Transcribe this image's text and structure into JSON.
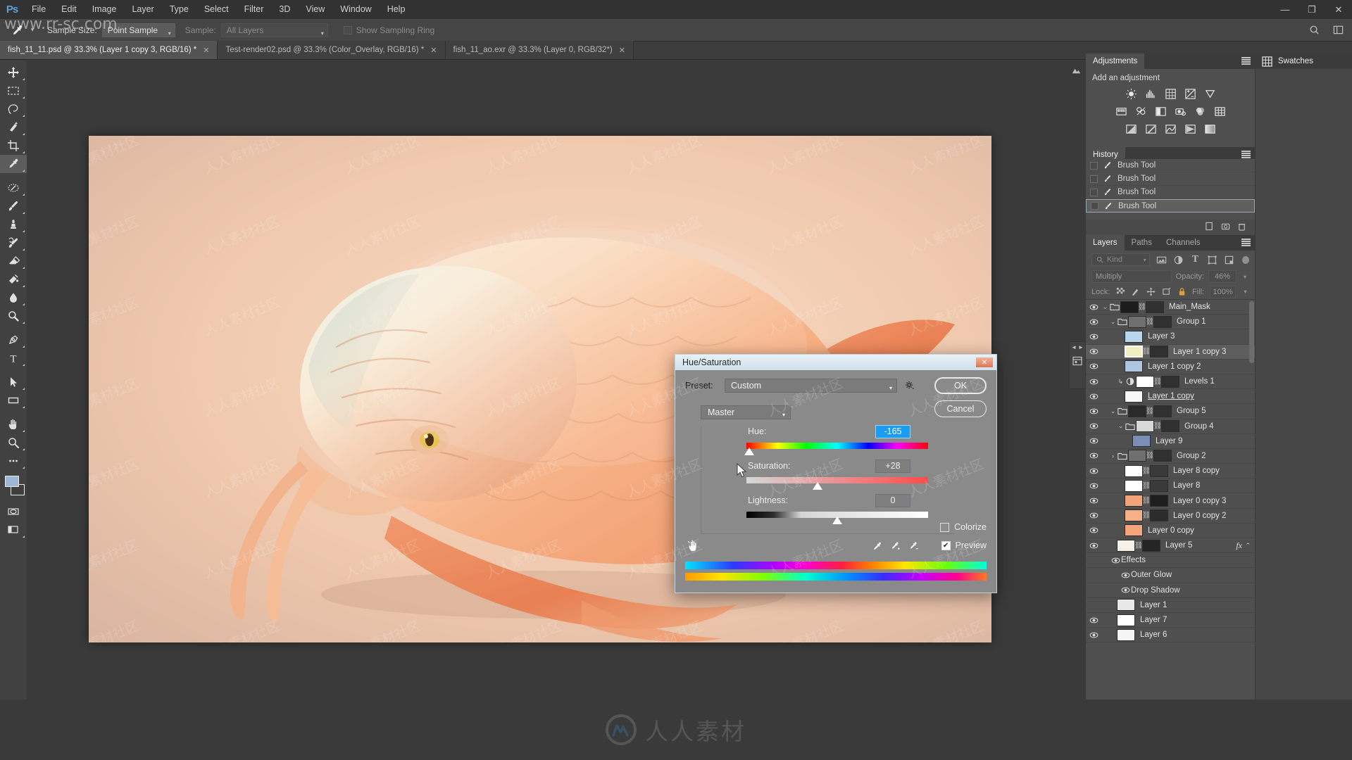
{
  "app": {
    "logo": "Ps",
    "watermark_site": "www.rr-sc.com",
    "watermark_brand": "人人素材",
    "watermark_tile": "人人素材社区"
  },
  "menubar": {
    "items": [
      "File",
      "Edit",
      "Image",
      "Layer",
      "Type",
      "Select",
      "Filter",
      "3D",
      "View",
      "Window",
      "Help"
    ]
  },
  "window_controls": {
    "minimize": "—",
    "restore": "❐",
    "close": "✕"
  },
  "options_bar": {
    "tool_icon": "eyedropper-icon",
    "sample_size_label": "Sample Size:",
    "sample_size_value": "Point Sample",
    "sample_label": "Sample:",
    "sample_value": "All Layers",
    "show_sampling_ring": "Show Sampling Ring"
  },
  "document_tabs": [
    {
      "title": "fish_11_11.psd @ 33.3% (Layer 1 copy 3, RGB/16) *",
      "close": "✕",
      "active": true
    },
    {
      "title": "Test-render02.psd @ 33.3% (Color_Overlay, RGB/16) *",
      "close": "✕",
      "active": false
    },
    {
      "title": "fish_11_ao.exr @ 33.3% (Layer 0, RGB/32*)",
      "close": "✕",
      "active": false
    }
  ],
  "toolbar": {
    "tools": [
      {
        "name": "move-tool",
        "glyph": "✥"
      },
      {
        "name": "rectangular-marquee-tool",
        "glyph": "▭"
      },
      {
        "name": "lasso-tool",
        "glyph": "✒"
      },
      {
        "name": "quick-selection-tool",
        "glyph": "✨"
      },
      {
        "name": "crop-tool",
        "glyph": "⌗"
      },
      {
        "name": "eyedropper-tool",
        "glyph": "⚲",
        "active": true
      },
      {
        "name": "spot-healing-brush-tool",
        "glyph": "✚"
      },
      {
        "name": "brush-tool",
        "glyph": "🖌"
      },
      {
        "name": "clone-stamp-tool",
        "glyph": "⎘"
      },
      {
        "name": "history-brush-tool",
        "glyph": "↺"
      },
      {
        "name": "eraser-tool",
        "glyph": "▰"
      },
      {
        "name": "gradient-tool",
        "glyph": "◨"
      },
      {
        "name": "blur-tool",
        "glyph": "💧"
      },
      {
        "name": "dodge-tool",
        "glyph": "🔍"
      },
      {
        "name": "pen-tool",
        "glyph": "✎"
      },
      {
        "name": "type-tool",
        "glyph": "T"
      },
      {
        "name": "path-selection-tool",
        "glyph": "➤"
      },
      {
        "name": "rectangle-tool",
        "glyph": "▭"
      },
      {
        "name": "hand-tool",
        "glyph": "✋"
      },
      {
        "name": "zoom-tool",
        "glyph": "🔎"
      },
      {
        "name": "edit-toolbar-tool",
        "glyph": "•••"
      }
    ],
    "foreground_color": "#9fb7d4",
    "background_color": "#3e3e3e",
    "quick-mask": "quick-mask-icon",
    "screen-mode": "screen-mode-icon"
  },
  "canvas": {
    "artwork_name": "dragon-fish-artwork",
    "zoom": "33.3%"
  },
  "adjustments_panel": {
    "tab_label": "Adjustments",
    "title": "Add an adjustment",
    "icons_row1": [
      "brightness-contrast-icon",
      "levels-icon",
      "curves-icon",
      "exposure-icon",
      "vibrance-icon"
    ],
    "icons_row2": [
      "hue-saturation-icon",
      "color-balance-icon",
      "black-white-icon",
      "photo-filter-icon",
      "channel-mixer-icon",
      "color-lookup-icon"
    ],
    "icons_row3": [
      "invert-icon",
      "posterize-icon",
      "threshold-icon",
      "gradient-map-icon",
      "selective-color-icon"
    ]
  },
  "history_panel": {
    "tab_label": "History",
    "entries": [
      {
        "label": "Brush Tool",
        "selected": false
      },
      {
        "label": "Brush Tool",
        "selected": false
      },
      {
        "label": "Brush Tool",
        "selected": false
      },
      {
        "label": "Brush Tool",
        "selected": true
      }
    ],
    "footer_icons": [
      "new-document-from-state-icon",
      "new-snapshot-icon",
      "delete-icon"
    ]
  },
  "layers_panel": {
    "tabs": [
      {
        "label": "Layers",
        "active": true
      },
      {
        "label": "Paths",
        "active": false
      },
      {
        "label": "Channels",
        "active": false
      }
    ],
    "filter": {
      "kind_label": "Kind",
      "icons": [
        "pixel-filter-icon",
        "adjustment-filter-icon",
        "type-filter-icon",
        "shape-filter-icon",
        "smart-object-filter-icon"
      ]
    },
    "blend_mode": "Multiply",
    "opacity_label": "Opacity:",
    "opacity_value": "46%",
    "lock_label": "Lock:",
    "lock_icons": [
      "lock-transparent-pixels-icon",
      "lock-image-pixels-icon",
      "lock-position-icon",
      "lock-artboard-icon",
      "lock-all-icon"
    ],
    "fill_label": "Fill:",
    "fill_value": "100%",
    "layers": [
      {
        "name": "Main_Mask",
        "indent": 0,
        "type": "group",
        "expanded": true,
        "visible": true,
        "thumb": "#1c1c1c",
        "mask": true,
        "selected": false
      },
      {
        "name": "Group 1",
        "indent": 1,
        "type": "group",
        "expanded": true,
        "visible": true,
        "thumb": "#6f6f6f",
        "mask": true,
        "selected": false
      },
      {
        "name": "Layer 3",
        "indent": 2,
        "type": "layer",
        "visible": true,
        "thumb": "#b9d6ef",
        "mask": false,
        "selected": false
      },
      {
        "name": "Layer 1 copy 3",
        "indent": 2,
        "type": "layer",
        "visible": true,
        "thumb": "#f2efbe",
        "mask": true,
        "selected": true
      },
      {
        "name": "Layer 1 copy 2",
        "indent": 2,
        "type": "layer",
        "visible": true,
        "thumb": "#aec6e0",
        "mask": false,
        "selected": false
      },
      {
        "name": "Levels 1",
        "indent": 2,
        "type": "adjustment",
        "visible": true,
        "thumb": "#ffffff",
        "mask": true,
        "clipped": true,
        "selected": false
      },
      {
        "name": "Layer 1 copy",
        "indent": 2,
        "type": "layer",
        "visible": true,
        "thumb": "#f6f6f6",
        "mask": false,
        "underline": true,
        "selected": false
      },
      {
        "name": "Group 5",
        "indent": 1,
        "type": "group",
        "expanded": true,
        "visible": true,
        "thumb": "#2a2a2a",
        "mask": true,
        "selected": false
      },
      {
        "name": "Group 4",
        "indent": 2,
        "type": "group",
        "expanded": true,
        "visible": true,
        "thumb": "#d8d8d8",
        "mask": true,
        "selected": false
      },
      {
        "name": "Layer 9",
        "indent": 3,
        "type": "layer",
        "visible": true,
        "thumb": "#7b8eb5",
        "mask": false,
        "selected": false
      },
      {
        "name": "Group 2",
        "indent": 1,
        "type": "group",
        "expanded": false,
        "visible": true,
        "thumb": "#6f6f6f",
        "mask": true,
        "selected": false
      },
      {
        "name": "Layer 8 copy",
        "indent": 2,
        "type": "layer",
        "visible": true,
        "thumb": "#ffffff",
        "mask": true,
        "maskcolor": "#3a3a3a",
        "selected": false
      },
      {
        "name": "Layer 8",
        "indent": 2,
        "type": "layer",
        "visible": true,
        "thumb": "#ffffff",
        "mask": true,
        "maskcolor": "#3a3a3a",
        "selected": false
      },
      {
        "name": "Layer 0 copy 3",
        "indent": 2,
        "type": "layer",
        "visible": true,
        "thumb": "#f4a277",
        "mask": true,
        "maskcolor": "#1e1e1e",
        "selected": false
      },
      {
        "name": "Layer 0 copy 2",
        "indent": 2,
        "type": "layer",
        "visible": true,
        "thumb": "#f6b089",
        "mask": true,
        "maskcolor": "#2c2c2c",
        "selected": false
      },
      {
        "name": "Layer 0 copy",
        "indent": 2,
        "type": "layer",
        "visible": true,
        "thumb": "#f4a57d",
        "mask": false,
        "selected": false
      },
      {
        "name": "Layer 5",
        "indent": 1,
        "type": "layer",
        "visible": true,
        "thumb": "#f5f2e8",
        "mask": true,
        "maskcolor": "#252525",
        "fx": "fx",
        "fxcaret": "⌃",
        "selected": false
      }
    ],
    "effects": {
      "label": "Effects",
      "items": [
        "Outer Glow",
        "Drop Shadow"
      ]
    },
    "layers_bottom": [
      {
        "name": "Layer 1",
        "indent": 1,
        "type": "layer",
        "visible": false,
        "thumb": "#e8e8e8"
      },
      {
        "name": "Layer 7",
        "indent": 1,
        "type": "layer",
        "visible": true,
        "thumb": "#ffffff"
      },
      {
        "name": "Layer 6",
        "indent": 1,
        "type": "layer",
        "visible": true,
        "thumb": "#f5f5f5"
      }
    ]
  },
  "swatches_panel": {
    "label": "Swatches",
    "icon": "swatches-grid-icon"
  },
  "dialog": {
    "title": "Hue/Saturation",
    "close": "✕",
    "preset_label": "Preset:",
    "preset_value": "Custom",
    "gear_icon": "preset-options-gear-icon",
    "ok_label": "OK",
    "cancel_label": "Cancel",
    "channel_value": "Master",
    "sliders": [
      {
        "label": "Hue:",
        "value": "-165",
        "focused": true,
        "thumb_percent": 1.5,
        "track": "hue"
      },
      {
        "label": "Saturation:",
        "value": "+28",
        "focused": false,
        "thumb_percent": 39,
        "track": "sat"
      },
      {
        "label": "Lightness:",
        "value": "0",
        "focused": false,
        "thumb_percent": 50,
        "track": "light"
      }
    ],
    "colorize_label": "Colorize",
    "colorize_checked": false,
    "preview_label": "Preview",
    "preview_checked": true,
    "preview_check_glyph": "✔",
    "eyedropper_icons": [
      "eyedropper-icon",
      "eyedropper-add-icon",
      "eyedropper-subtract-icon"
    ],
    "hand_icon": "on-image-adjustment-icon"
  }
}
